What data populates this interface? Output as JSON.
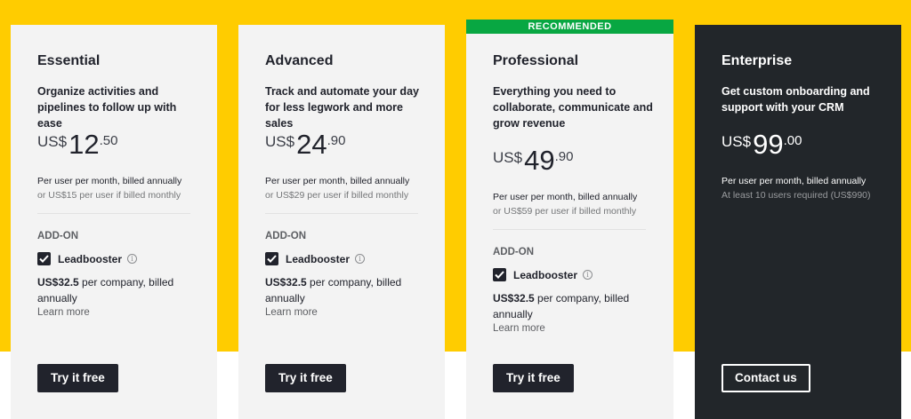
{
  "banner": {
    "recommended": "RECOMMENDED"
  },
  "colors": {
    "background_band": "#ffcc00",
    "card": "#f3f3f3",
    "enterprise_card": "#22262a",
    "banner": "#08a742",
    "button": "#21232c"
  },
  "plans": [
    {
      "name": "Essential",
      "tagline": "Organize activities and pipelines to follow up with ease",
      "currency": "US$",
      "amount": "12",
      "cents": ".50",
      "billing_main": "Per user per month, billed annually",
      "billing_sub": "or US$15 per user if billed monthly",
      "addon_title": "ADD-ON",
      "addon_label": "Leadbooster",
      "addon_price": "US$32.5",
      "addon_price_rest": " per company, billed annually",
      "learn_more": "Learn more",
      "button": "Try it free"
    },
    {
      "name": "Advanced",
      "tagline": "Track and automate your day for less legwork and more sales",
      "currency": "US$",
      "amount": "24",
      "cents": ".90",
      "billing_main": "Per user per month, billed annually",
      "billing_sub": "or US$29 per user if billed monthly",
      "addon_title": "ADD-ON",
      "addon_label": "Leadbooster",
      "addon_price": "US$32.5",
      "addon_price_rest": " per company, billed annually",
      "learn_more": "Learn more",
      "button": "Try it free"
    },
    {
      "name": "Professional",
      "tagline": "Everything you need to collaborate, communicate and grow revenue",
      "currency": "US$",
      "amount": "49",
      "cents": ".90",
      "billing_main": "Per user per month, billed annually",
      "billing_sub": "or US$59 per user if billed monthly",
      "addon_title": "ADD-ON",
      "addon_label": "Leadbooster",
      "addon_price": "US$32.5",
      "addon_price_rest": " per company, billed annually",
      "learn_more": "Learn more",
      "button": "Try it free"
    },
    {
      "name": "Enterprise",
      "tagline": "Get custom onboarding and support with your CRM",
      "currency": "US$",
      "amount": "99",
      "cents": ".00",
      "billing_main": "Per user per month, billed annually",
      "billing_sub": "At least 10 users required (US$990)",
      "button": "Contact us"
    }
  ]
}
